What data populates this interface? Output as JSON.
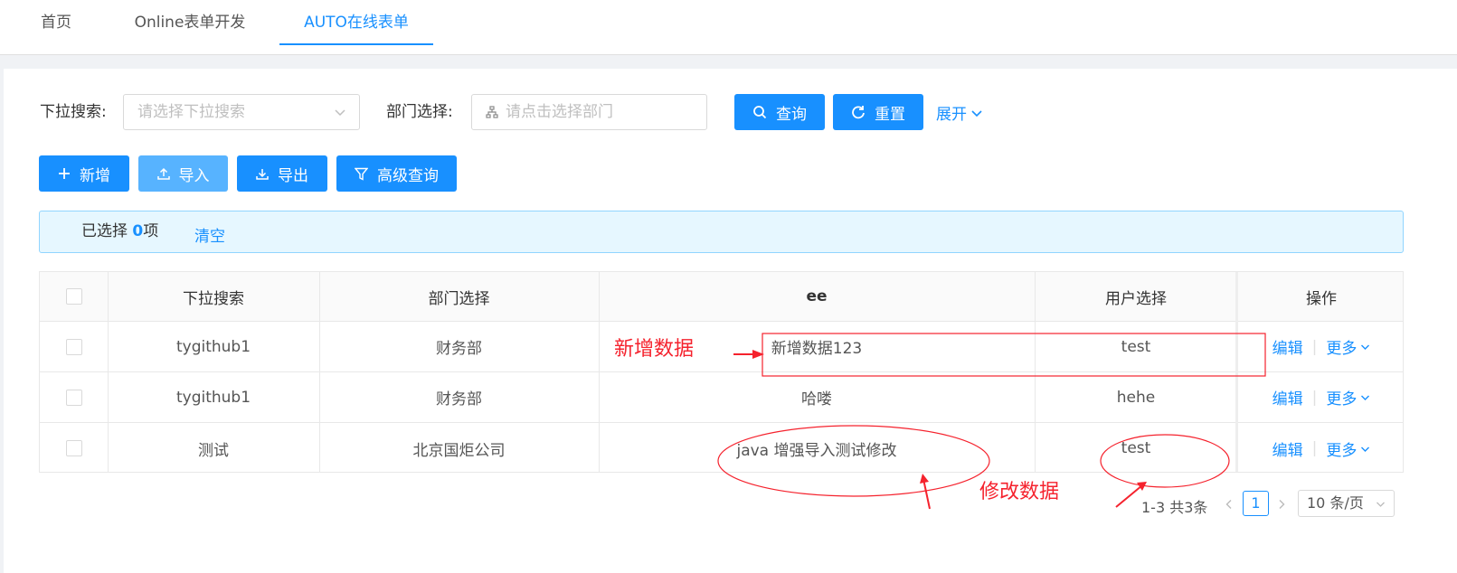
{
  "tabs": [
    {
      "label": "首页"
    },
    {
      "label": "Online表单开发"
    },
    {
      "label": "AUTO在线表单"
    }
  ],
  "search": {
    "dropdown_label": "下拉搜索:",
    "dropdown_placeholder": "请选择下拉搜索",
    "dept_label": "部门选择:",
    "dept_placeholder": "请点击选择部门",
    "query_button": "查询",
    "reset_button": "重置",
    "expand_link": "展开"
  },
  "toolbar": {
    "add": "新增",
    "import": "导入",
    "export": "导出",
    "advanced_query": "高级查询"
  },
  "selection": {
    "prefix": "已选择 ",
    "count": "0",
    "suffix": "项",
    "clear": "清空"
  },
  "table": {
    "headers": [
      "下拉搜索",
      "部门选择",
      "ee",
      "用户选择",
      "操作"
    ],
    "rows": [
      {
        "dropdown": "tygithub1",
        "dept": "财务部",
        "ee": "新增数据123",
        "user": "test"
      },
      {
        "dropdown": "tygithub1",
        "dept": "财务部",
        "ee": "哈喽",
        "user": "hehe"
      },
      {
        "dropdown": "测试",
        "dept": "北京国炬公司",
        "ee": "java 增强导入测试修改",
        "user": "test"
      }
    ],
    "edit_label": "编辑",
    "more_label": "更多"
  },
  "annotations": {
    "added": "新增数据",
    "modified": "修改数据"
  },
  "pagination": {
    "summary": "1-3 共3条",
    "current_page": "1",
    "page_size": "10 条/页"
  },
  "colors": {
    "primary": "#1890ff",
    "annotation": "#f5222d"
  }
}
